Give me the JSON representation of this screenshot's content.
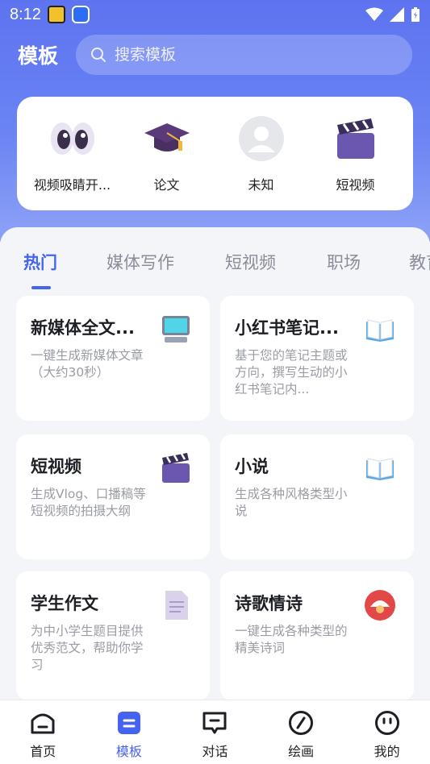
{
  "status_bar": {
    "time": "8:12"
  },
  "header": {
    "title": "模板"
  },
  "search": {
    "placeholder": "搜索模板"
  },
  "categories": [
    {
      "label": "视频吸睛开...",
      "icon": "eyes-icon"
    },
    {
      "label": "论文",
      "icon": "graduation-cap-icon"
    },
    {
      "label": "未知",
      "icon": "avatar-placeholder-icon"
    },
    {
      "label": "短视频",
      "icon": "clapperboard-icon"
    }
  ],
  "tabs": [
    {
      "label": "热门",
      "active": true
    },
    {
      "label": "媒体写作"
    },
    {
      "label": "短视频"
    },
    {
      "label": "职场"
    },
    {
      "label": "教育"
    }
  ],
  "templates": [
    {
      "title": "新媒体全文...",
      "desc": "一键生成新媒体文章（大约30秒）",
      "icon": "computer-icon"
    },
    {
      "title": "小红书笔记...",
      "desc": "基于您的笔记主题或方向，撰写生动的小红书笔记内...",
      "icon": "open-book-icon"
    },
    {
      "title": "短视频",
      "desc": "生成Vlog、口播稿等短视频的拍摄大纲",
      "icon": "clapperboard-icon"
    },
    {
      "title": "小说",
      "desc": "生成各种风格类型小说",
      "icon": "open-book-icon"
    },
    {
      "title": "学生作文",
      "desc": "为中小学生题目提供优秀范文，帮助你学习",
      "icon": "document-icon"
    },
    {
      "title": "诗歌情诗",
      "desc": "一键生成各种类型的精美诗词",
      "icon": "poetry-fan-icon"
    }
  ],
  "bottom_nav": [
    {
      "label": "首页",
      "icon": "home-icon"
    },
    {
      "label": "模板",
      "icon": "template-icon",
      "active": true
    },
    {
      "label": "对话",
      "icon": "chat-icon"
    },
    {
      "label": "绘画",
      "icon": "paint-icon"
    },
    {
      "label": "我的",
      "icon": "profile-icon"
    }
  ],
  "colors": {
    "accent": "#4463ee",
    "hero": "#6a84f4",
    "background": "#f4f5f9"
  }
}
